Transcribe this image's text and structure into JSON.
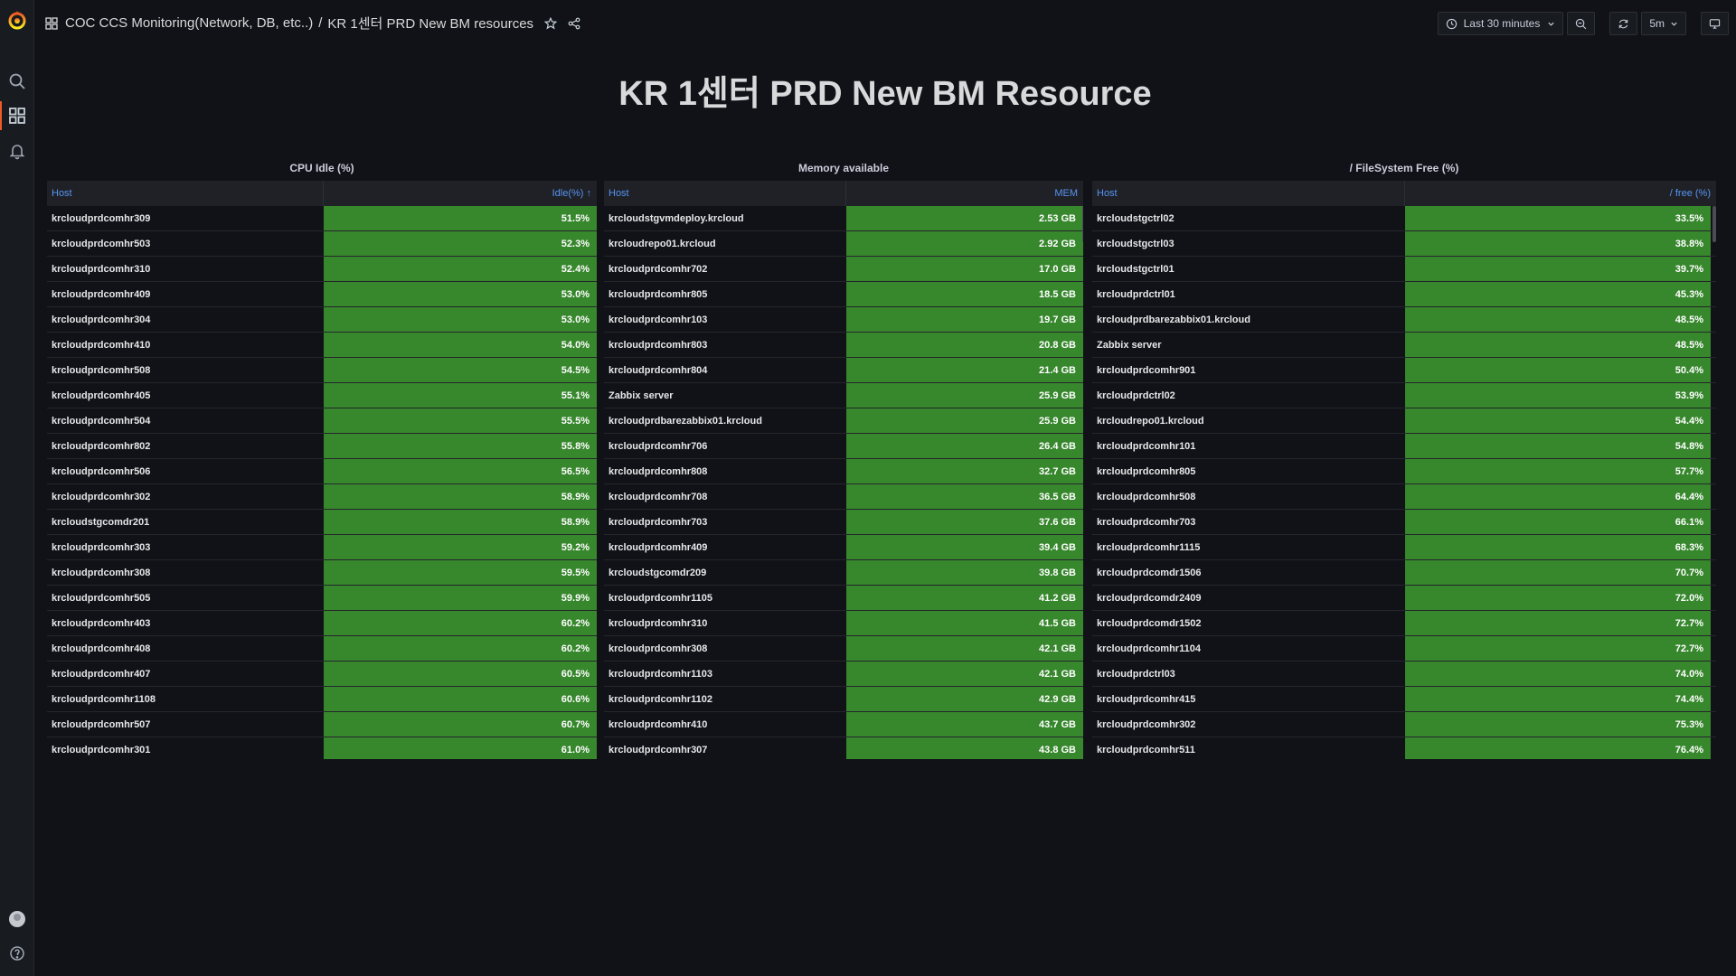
{
  "breadcrumb": {
    "folder": "COC CCS Monitoring(Network, DB, etc..)",
    "separator": "/",
    "dashboard": "KR 1센터 PRD New BM resources"
  },
  "toolbar": {
    "time_range": "Last 30 minutes",
    "refresh_interval": "5m"
  },
  "page_title": "KR 1센터 PRD New BM Resource",
  "panels": {
    "cpu": {
      "title": "CPU Idle (%)",
      "col_host": "Host",
      "col_value": "Idle(%) ↑",
      "rows": [
        {
          "host": "krcloudprdcomhr309",
          "value": "51.5%"
        },
        {
          "host": "krcloudprdcomhr503",
          "value": "52.3%"
        },
        {
          "host": "krcloudprdcomhr310",
          "value": "52.4%"
        },
        {
          "host": "krcloudprdcomhr409",
          "value": "53.0%"
        },
        {
          "host": "krcloudprdcomhr304",
          "value": "53.0%"
        },
        {
          "host": "krcloudprdcomhr410",
          "value": "54.0%"
        },
        {
          "host": "krcloudprdcomhr508",
          "value": "54.5%"
        },
        {
          "host": "krcloudprdcomhr405",
          "value": "55.1%"
        },
        {
          "host": "krcloudprdcomhr504",
          "value": "55.5%"
        },
        {
          "host": "krcloudprdcomhr802",
          "value": "55.8%"
        },
        {
          "host": "krcloudprdcomhr506",
          "value": "56.5%"
        },
        {
          "host": "krcloudprdcomhr302",
          "value": "58.9%"
        },
        {
          "host": "krcloudstgcomdr201",
          "value": "58.9%"
        },
        {
          "host": "krcloudprdcomhr303",
          "value": "59.2%"
        },
        {
          "host": "krcloudprdcomhr308",
          "value": "59.5%"
        },
        {
          "host": "krcloudprdcomhr505",
          "value": "59.9%"
        },
        {
          "host": "krcloudprdcomhr403",
          "value": "60.2%"
        },
        {
          "host": "krcloudprdcomhr408",
          "value": "60.2%"
        },
        {
          "host": "krcloudprdcomhr407",
          "value": "60.5%"
        },
        {
          "host": "krcloudprdcomhr1108",
          "value": "60.6%"
        },
        {
          "host": "krcloudprdcomhr507",
          "value": "60.7%"
        },
        {
          "host": "krcloudprdcomhr301",
          "value": "61.0%"
        }
      ]
    },
    "mem": {
      "title": "Memory available",
      "col_host": "Host",
      "col_value": "MEM",
      "rows": [
        {
          "host": "krcloudstgvmdeploy.krcloud",
          "value": "2.53 GB"
        },
        {
          "host": "krcloudrepo01.krcloud",
          "value": "2.92 GB"
        },
        {
          "host": "krcloudprdcomhr702",
          "value": "17.0 GB"
        },
        {
          "host": "krcloudprdcomhr805",
          "value": "18.5 GB"
        },
        {
          "host": "krcloudprdcomhr103",
          "value": "19.7 GB"
        },
        {
          "host": "krcloudprdcomhr803",
          "value": "20.8 GB"
        },
        {
          "host": "krcloudprdcomhr804",
          "value": "21.4 GB"
        },
        {
          "host": "Zabbix server",
          "value": "25.9 GB"
        },
        {
          "host": "krcloudprdbarezabbix01.krcloud",
          "value": "25.9 GB"
        },
        {
          "host": "krcloudprdcomhr706",
          "value": "26.4 GB"
        },
        {
          "host": "krcloudprdcomhr808",
          "value": "32.7 GB"
        },
        {
          "host": "krcloudprdcomhr708",
          "value": "36.5 GB"
        },
        {
          "host": "krcloudprdcomhr703",
          "value": "37.6 GB"
        },
        {
          "host": "krcloudprdcomhr409",
          "value": "39.4 GB"
        },
        {
          "host": "krcloudstgcomdr209",
          "value": "39.8 GB"
        },
        {
          "host": "krcloudprdcomhr1105",
          "value": "41.2 GB"
        },
        {
          "host": "krcloudprdcomhr310",
          "value": "41.5 GB"
        },
        {
          "host": "krcloudprdcomhr308",
          "value": "42.1 GB"
        },
        {
          "host": "krcloudprdcomhr1103",
          "value": "42.1 GB"
        },
        {
          "host": "krcloudprdcomhr1102",
          "value": "42.9 GB"
        },
        {
          "host": "krcloudprdcomhr410",
          "value": "43.7 GB"
        },
        {
          "host": "krcloudprdcomhr307",
          "value": "43.8 GB"
        }
      ]
    },
    "fs": {
      "title": "/ FileSystem Free (%)",
      "col_host": "Host",
      "col_value": "/ free (%)",
      "rows": [
        {
          "host": "krcloudstgctrl02",
          "value": "33.5%"
        },
        {
          "host": "krcloudstgctrl03",
          "value": "38.8%"
        },
        {
          "host": "krcloudstgctrl01",
          "value": "39.7%"
        },
        {
          "host": "krcloudprdctrl01",
          "value": "45.3%"
        },
        {
          "host": "krcloudprdbarezabbix01.krcloud",
          "value": "48.5%"
        },
        {
          "host": "Zabbix server",
          "value": "48.5%"
        },
        {
          "host": "krcloudprdcomhr901",
          "value": "50.4%"
        },
        {
          "host": "krcloudprdctrl02",
          "value": "53.9%"
        },
        {
          "host": "krcloudrepo01.krcloud",
          "value": "54.4%"
        },
        {
          "host": "krcloudprdcomhr101",
          "value": "54.8%"
        },
        {
          "host": "krcloudprdcomhr805",
          "value": "57.7%"
        },
        {
          "host": "krcloudprdcomhr508",
          "value": "64.4%"
        },
        {
          "host": "krcloudprdcomhr703",
          "value": "66.1%"
        },
        {
          "host": "krcloudprdcomhr1115",
          "value": "68.3%"
        },
        {
          "host": "krcloudprdcomdr1506",
          "value": "70.7%"
        },
        {
          "host": "krcloudprdcomdr2409",
          "value": "72.0%"
        },
        {
          "host": "krcloudprdcomdr1502",
          "value": "72.7%"
        },
        {
          "host": "krcloudprdcomhr1104",
          "value": "72.7%"
        },
        {
          "host": "krcloudprdctrl03",
          "value": "74.0%"
        },
        {
          "host": "krcloudprdcomhr415",
          "value": "74.4%"
        },
        {
          "host": "krcloudprdcomhr302",
          "value": "75.3%"
        },
        {
          "host": "krcloudprdcomhr511",
          "value": "76.4%"
        }
      ]
    }
  },
  "colors": {
    "background": "#111217",
    "cell_green": "#37872d",
    "header_text": "#5794f2",
    "accent": "#f05a28"
  }
}
